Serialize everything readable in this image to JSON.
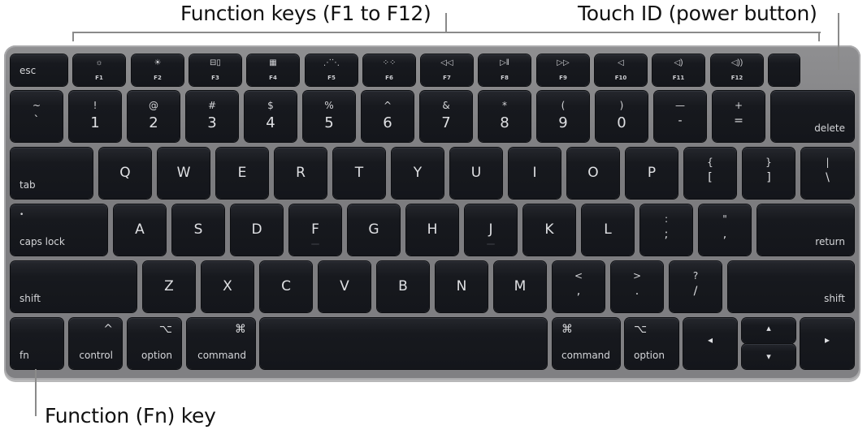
{
  "callouts": {
    "function_keys": "Function keys (F1 to F12)",
    "touch_id": "Touch ID (power button)",
    "fn_key": "Function (Fn) key"
  },
  "keyboard": {
    "function_row": [
      {
        "label": "esc"
      },
      {
        "label": "F1",
        "icon": "☼",
        "icon_name": "brightness-down-icon"
      },
      {
        "label": "F2",
        "icon": "☀",
        "icon_name": "brightness-up-icon"
      },
      {
        "label": "F3",
        "icon": "⊟▯",
        "icon_name": "mission-control-icon"
      },
      {
        "label": "F4",
        "icon": "▦",
        "icon_name": "launchpad-icon"
      },
      {
        "label": "F5",
        "icon": "⋰⋱",
        "icon_name": "keyboard-backlight-down-icon"
      },
      {
        "label": "F6",
        "icon": "⁘⁘",
        "icon_name": "keyboard-backlight-up-icon"
      },
      {
        "label": "F7",
        "icon": "◁◁",
        "icon_name": "rewind-icon"
      },
      {
        "label": "F8",
        "icon": "▷ǁ",
        "icon_name": "play-pause-icon"
      },
      {
        "label": "F9",
        "icon": "▷▷",
        "icon_name": "fast-forward-icon"
      },
      {
        "label": "F10",
        "icon": "◁",
        "icon_name": "mute-icon"
      },
      {
        "label": "F11",
        "icon": "◁)",
        "icon_name": "volume-down-icon"
      },
      {
        "label": "F12",
        "icon": "◁))",
        "icon_name": "volume-up-icon"
      },
      {
        "label": "",
        "name": "touch-id"
      }
    ],
    "number_row": [
      {
        "top": "~",
        "bottom": "`"
      },
      {
        "top": "!",
        "bottom": "1"
      },
      {
        "top": "@",
        "bottom": "2"
      },
      {
        "top": "#",
        "bottom": "3"
      },
      {
        "top": "$",
        "bottom": "4"
      },
      {
        "top": "%",
        "bottom": "5"
      },
      {
        "top": "^",
        "bottom": "6"
      },
      {
        "top": "&",
        "bottom": "7"
      },
      {
        "top": "*",
        "bottom": "8"
      },
      {
        "top": "(",
        "bottom": "9"
      },
      {
        "top": ")",
        "bottom": "0"
      },
      {
        "top": "—",
        "bottom": "-"
      },
      {
        "top": "+",
        "bottom": "="
      },
      {
        "label": "delete"
      }
    ],
    "qwerty_row": {
      "tab": "tab",
      "letters": [
        "Q",
        "W",
        "E",
        "R",
        "T",
        "Y",
        "U",
        "I",
        "O",
        "P"
      ],
      "symbols": [
        {
          "top": "{",
          "bottom": "["
        },
        {
          "top": "}",
          "bottom": "]"
        },
        {
          "top": "|",
          "bottom": "\\"
        }
      ]
    },
    "home_row": {
      "caps": "caps lock",
      "caps_indicator": "•",
      "letters": [
        "A",
        "S",
        "D",
        "F",
        "G",
        "H",
        "J",
        "K",
        "L"
      ],
      "symbols": [
        {
          "top": ":",
          "bottom": ";"
        },
        {
          "top": "\"",
          "bottom": ","
        }
      ],
      "return": "return"
    },
    "shift_row": {
      "left_shift": "shift",
      "letters": [
        "Z",
        "X",
        "C",
        "V",
        "B",
        "N",
        "M"
      ],
      "symbols": [
        {
          "top": "<",
          "bottom": ","
        },
        {
          "top": ">",
          "bottom": "."
        },
        {
          "top": "?",
          "bottom": "/"
        }
      ],
      "right_shift": "shift"
    },
    "bottom_row": {
      "fn": "fn",
      "control": {
        "label": "control",
        "symbol": "^"
      },
      "option_left": {
        "label": "option",
        "symbol": "⌥"
      },
      "command_left": {
        "label": "command",
        "symbol": "⌘"
      },
      "command_right": {
        "label": "command",
        "symbol": "⌘"
      },
      "option_right": {
        "label": "option",
        "symbol": "⌥"
      },
      "arrows": {
        "left": "◂",
        "up": "▴",
        "down": "▾",
        "right": "▸"
      }
    }
  }
}
